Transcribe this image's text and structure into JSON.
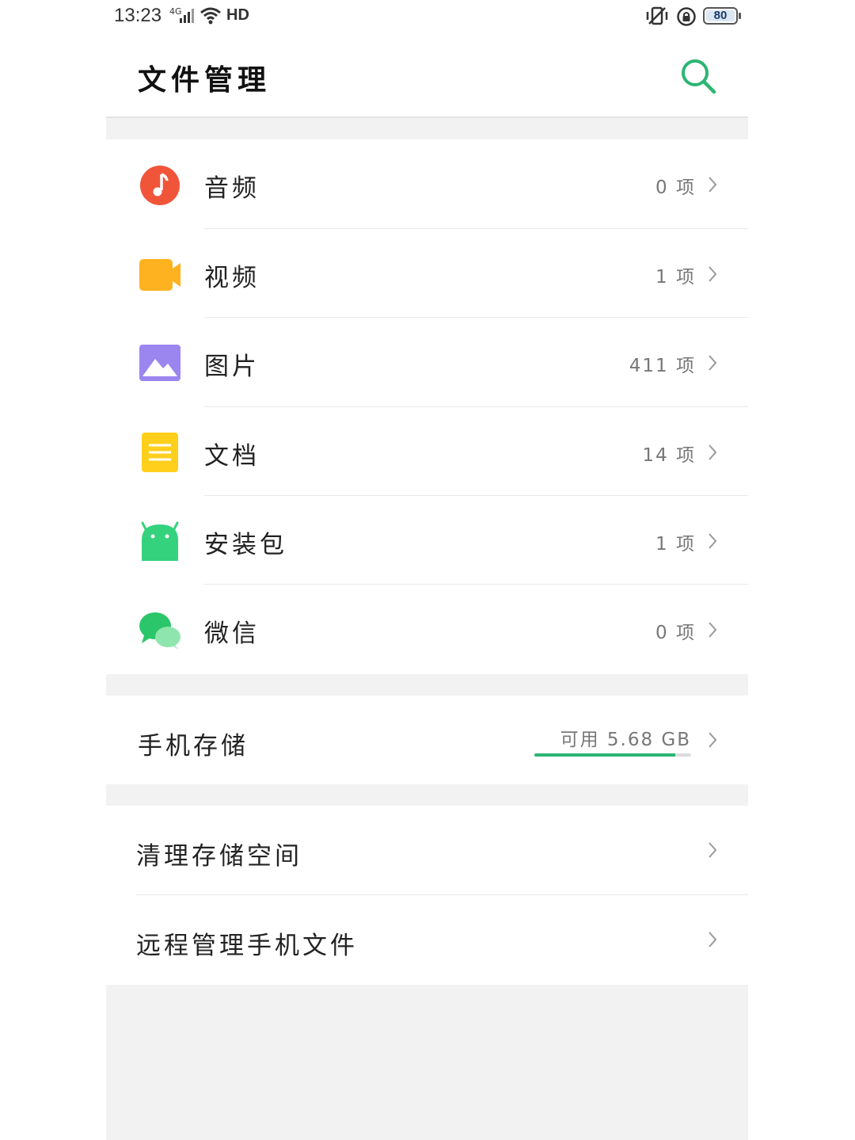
{
  "status_bar": {
    "time": "13:23",
    "network": "4G",
    "hd": "HD",
    "battery": "80"
  },
  "header": {
    "title": "文件管理",
    "search_icon": "search-icon"
  },
  "categories": [
    {
      "label": "音频",
      "count": "0 项",
      "icon": "music-note-icon",
      "color": "#f0553a"
    },
    {
      "label": "视频",
      "count": "1 项",
      "icon": "video-camera-icon",
      "color": "#ffb21f"
    },
    {
      "label": "图片",
      "count": "411 项",
      "icon": "picture-icon",
      "color": "#9b86f0"
    },
    {
      "label": "文档",
      "count": "14 项",
      "icon": "document-icon",
      "color": "#ffcf1c"
    },
    {
      "label": "安装包",
      "count": "1 项",
      "icon": "android-icon",
      "color": "#34d27d"
    },
    {
      "label": "微信",
      "count": "0 项",
      "icon": "wechat-icon",
      "color": "#2bc66a"
    }
  ],
  "storage": {
    "label": "手机存储",
    "available": "可用 5.68 GB",
    "used_fraction": 0.9,
    "bar_color": "#2bb673"
  },
  "actions": [
    {
      "label": "清理存储空间"
    },
    {
      "label": "远程管理手机文件"
    }
  ],
  "colors": {
    "accent": "#2bb673",
    "separator": "#f2f2f2"
  }
}
